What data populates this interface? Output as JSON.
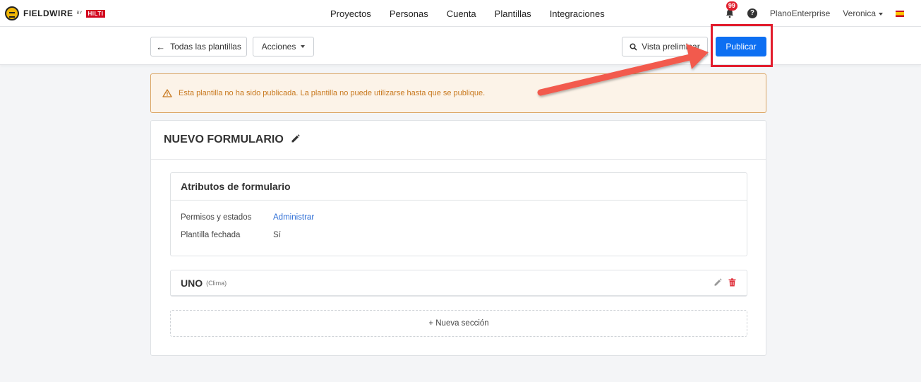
{
  "brand": {
    "name": "FIELDWIRE",
    "by": "BY",
    "partner": "HILTI"
  },
  "nav": {
    "links": [
      "Proyectos",
      "Personas",
      "Cuenta",
      "Plantillas",
      "Integraciones"
    ],
    "notifications_count": "99",
    "help": "?",
    "org": "PlanoEnterprise",
    "user": "Veronica"
  },
  "toolbar": {
    "back_label": "Todas las plantillas",
    "actions_label": "Acciones",
    "preview_label": "Vista preliminar",
    "publish_label": "Publicar"
  },
  "warning": {
    "text": "Esta plantilla no ha sido publicada. La plantilla no puede utilizarse hasta que se publique."
  },
  "form": {
    "title": "NUEVO FORMULARIO",
    "attributes": {
      "heading": "Atributos de formulario",
      "rows": [
        {
          "label": "Permisos y estados",
          "value": "Administrar"
        },
        {
          "label": "Plantilla fechada",
          "value": "Sí"
        }
      ]
    },
    "sections": [
      {
        "name": "UNO",
        "type": "(Clima)"
      }
    ],
    "new_section_label": "+ Nueva sección"
  },
  "colors": {
    "primary": "#0d6ff2",
    "warning_text": "#c8791f",
    "warning_border": "#dba563",
    "annotation": "#e21d2d",
    "badge": "#e0202e"
  }
}
